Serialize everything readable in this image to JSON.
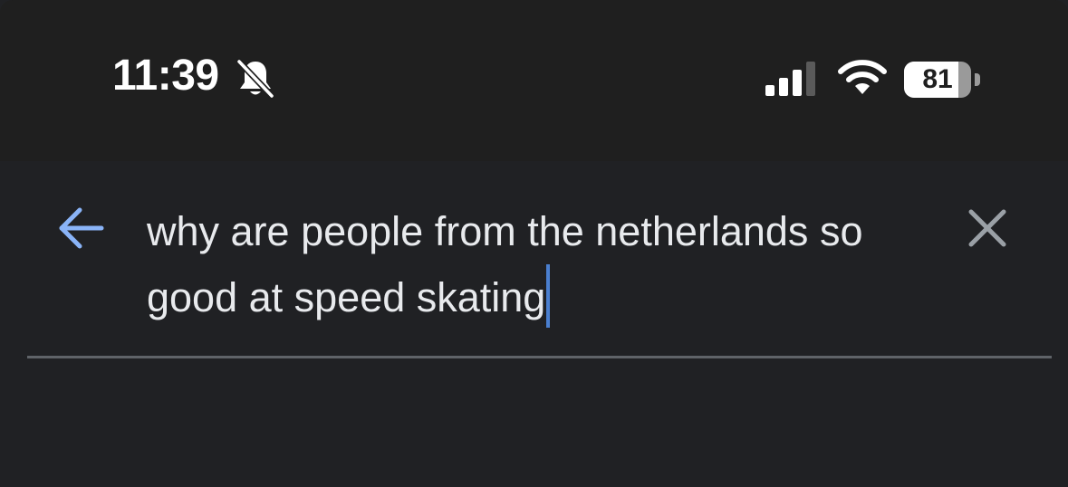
{
  "status_bar": {
    "time": "11:39",
    "icons": {
      "mute": "bell-slash-icon",
      "signal": "cellular-signal-icon",
      "wifi": "wifi-icon"
    },
    "battery_level": "81",
    "battery_fraction": 0.81
  },
  "search": {
    "back_icon": "arrow-left-icon",
    "query": "why are people from the netherlands so good at speed skating",
    "clear_icon": "close-x-icon"
  },
  "colors": {
    "background": "#202124",
    "status_bar_bg": "#1f1f1f",
    "back_arrow": "#8ab4f8",
    "text": "#e8eaed",
    "clear_icon": "#9aa0a6",
    "caret": "#4a7fd0",
    "divider": "#5f6368"
  }
}
